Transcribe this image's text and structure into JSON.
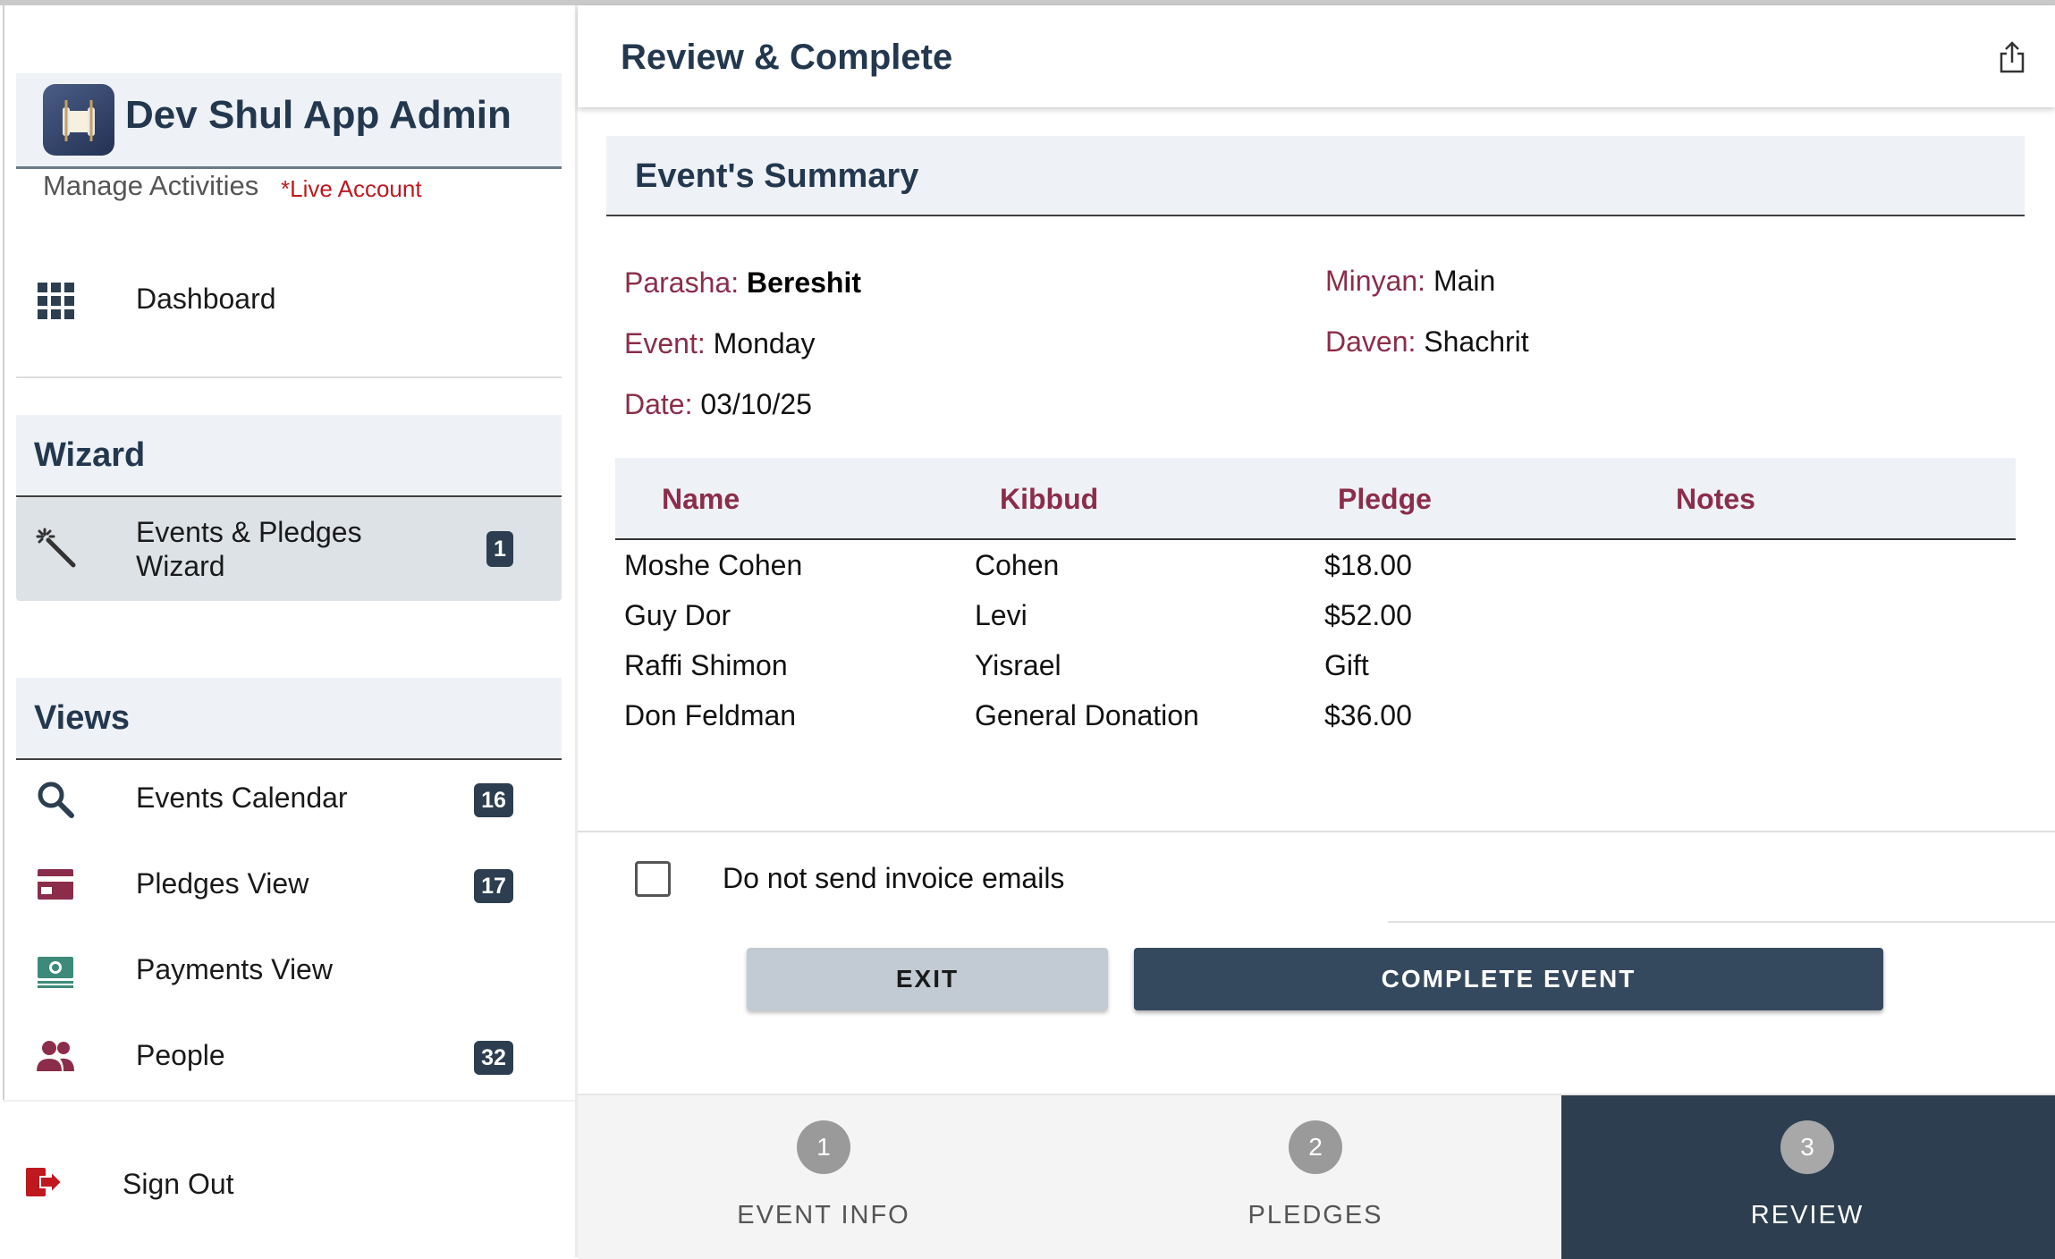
{
  "sidebar": {
    "brand_title": "Dev Shul App Admin",
    "subtitle": "Manage Activities",
    "account_status": "*Live Account",
    "dashboard_label": "Dashboard",
    "wizard_section": "Wizard",
    "wizard_item": {
      "label_line1": "Events & Pledges",
      "label_line2": "Wizard",
      "badge": "1"
    },
    "views_section": "Views",
    "views": [
      {
        "label": "Events Calendar",
        "badge": "16",
        "icon": "search-icon"
      },
      {
        "label": "Pledges View",
        "badge": "17",
        "icon": "credit-card-icon"
      },
      {
        "label": "Payments View",
        "badge": "",
        "icon": "money-icon"
      },
      {
        "label": "People",
        "badge": "32",
        "icon": "people-icon"
      }
    ],
    "signout_label": "Sign Out"
  },
  "header": {
    "title": "Review & Complete"
  },
  "summary": {
    "heading": "Event's Summary",
    "parasha_label": "Parasha:",
    "parasha_value": "Bereshit",
    "event_label": "Event:",
    "event_value": "Monday",
    "date_label": "Date:",
    "date_value": "03/10/25",
    "minyan_label": "Minyan:",
    "minyan_value": "Main",
    "daven_label": "Daven:",
    "daven_value": "Shachrit"
  },
  "table": {
    "columns": [
      "Name",
      "Kibbud",
      "Pledge",
      "Notes"
    ],
    "rows": [
      [
        "Moshe Cohen",
        "Cohen",
        "$18.00",
        ""
      ],
      [
        "Guy Dor",
        "Levi",
        "$52.00",
        ""
      ],
      [
        "Raffi Shimon",
        "Yisrael",
        "Gift",
        ""
      ],
      [
        "Don Feldman",
        "General Donation",
        "$36.00",
        ""
      ]
    ]
  },
  "options": {
    "no_invoice_label": "Do not send invoice emails",
    "no_invoice_checked": false
  },
  "buttons": {
    "exit": "EXIT",
    "complete": "COMPLETE EVENT"
  },
  "steps": [
    {
      "num": "1",
      "label": "EVENT INFO"
    },
    {
      "num": "2",
      "label": "PLEDGES"
    },
    {
      "num": "3",
      "label": "REVIEW"
    }
  ],
  "colors": {
    "accent_dark": "#2c3e50",
    "label_maroon": "#8b2d4a",
    "live_red": "#c0181f"
  }
}
